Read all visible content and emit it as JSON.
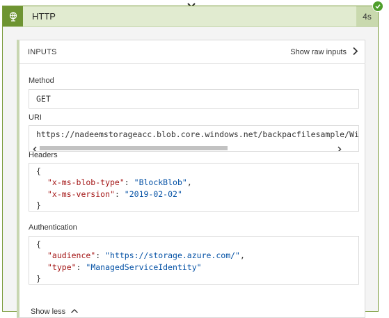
{
  "action": {
    "title": "HTTP",
    "duration": "4s",
    "status": "succeeded"
  },
  "inputs": {
    "section_title": "INPUTS",
    "show_raw_label": "Show raw inputs",
    "method": {
      "label": "Method",
      "value": "GET"
    },
    "uri": {
      "label": "URI",
      "value": "https://nadeemstorageacc.blob.core.windows.net/backpacfilesample/Wi"
    },
    "headers": {
      "label": "Headers",
      "open": "{",
      "close": "}",
      "entries": [
        {
          "key": "\"x-ms-blob-type\"",
          "sep": ": ",
          "value": "\"BlockBlob\"",
          "trail": ","
        },
        {
          "key": "\"x-ms-version\"",
          "sep": ": ",
          "value": "\"2019-02-02\"",
          "trail": ""
        }
      ]
    },
    "authentication": {
      "label": "Authentication",
      "open": "{",
      "close": "}",
      "entries": [
        {
          "key": "\"audience\"",
          "sep": ": ",
          "value": "\"https://storage.azure.com/\"",
          "trail": ","
        },
        {
          "key": "\"type\"",
          "sep": ": ",
          "value": "\"ManagedServiceIdentity\"",
          "trail": ""
        }
      ]
    },
    "show_less_label": "Show less"
  },
  "colors": {
    "accent_green": "#6e9432",
    "header_bg": "#e1ebd0",
    "json_key": "#a31515",
    "json_string": "#0451a5",
    "success": "#4f9e2b"
  },
  "icons": {
    "action": "globe-icon",
    "status": "check-icon",
    "raw_inputs": "chevron-right-icon",
    "show_less": "chevron-up-icon",
    "connector": "chevron-down-icon"
  }
}
